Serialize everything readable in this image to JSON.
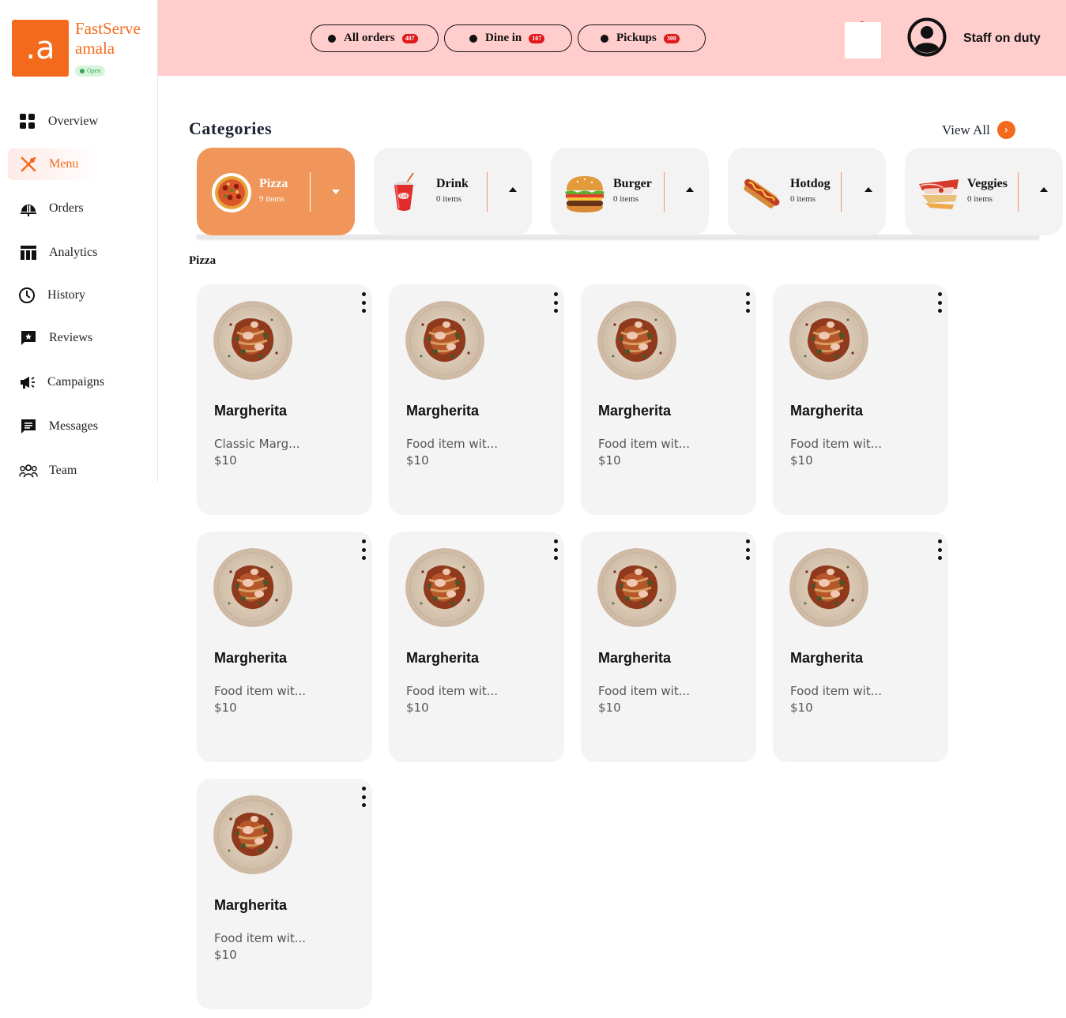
{
  "brand": {
    "logo": ".a",
    "name_line1": "FastServe",
    "name_line2": "amala",
    "status": "Open"
  },
  "nav": [
    {
      "label": "Overview",
      "icon": "grid-icon"
    },
    {
      "label": "Menu",
      "icon": "utensils-icon",
      "active": true
    },
    {
      "label": "Orders",
      "icon": "cloche-icon"
    },
    {
      "label": "Analytics",
      "icon": "table-icon"
    },
    {
      "label": "History",
      "icon": "clock-icon"
    },
    {
      "label": "Reviews",
      "icon": "review-icon"
    },
    {
      "label": "Campaigns",
      "icon": "megaphone-icon"
    },
    {
      "label": "Messages",
      "icon": "message-icon"
    },
    {
      "label": "Team",
      "icon": "team-icon"
    }
  ],
  "topbar": {
    "pills": [
      {
        "label": "All orders",
        "count": "407"
      },
      {
        "label": "Dine in",
        "count": "107"
      },
      {
        "label": "Pickups",
        "count": "300"
      }
    ],
    "staff_label": "Staff on duty"
  },
  "categories": {
    "title": "Categories",
    "view_all": "View All",
    "items": [
      {
        "name": "Pizza",
        "count": "9 items",
        "icon": "pizza-icon",
        "active": true
      },
      {
        "name": "Drink",
        "count": "0 items",
        "icon": "drink-icon"
      },
      {
        "name": "Burger",
        "count": "0 items",
        "icon": "burger-icon"
      },
      {
        "name": "Hotdog",
        "count": "0 items",
        "icon": "hotdog-icon"
      },
      {
        "name": "Veggies",
        "count": "0 items",
        "icon": "veggies-icon"
      }
    ]
  },
  "section": {
    "label": "Pizza"
  },
  "menu_items": [
    {
      "name": "Margherita",
      "desc": "Classic Marg...",
      "price": "$10"
    },
    {
      "name": "Margherita",
      "desc": "Food item wit...",
      "price": "$10"
    },
    {
      "name": "Margherita",
      "desc": "Food item wit...",
      "price": "$10"
    },
    {
      "name": "Margherita",
      "desc": "Food item wit...",
      "price": "$10"
    },
    {
      "name": "Margherita",
      "desc": "Food item wit...",
      "price": "$10"
    },
    {
      "name": "Margherita",
      "desc": "Food item wit...",
      "price": "$10"
    },
    {
      "name": "Margherita",
      "desc": "Food item wit...",
      "price": "$10"
    },
    {
      "name": "Margherita",
      "desc": "Food item wit...",
      "price": "$10"
    },
    {
      "name": "Margherita",
      "desc": "Food item wit...",
      "price": "$10"
    }
  ],
  "colors": {
    "accent": "#f46a1c",
    "topbar": "#ffcdcc",
    "active_category": "#f0965a",
    "badge": "#e11818"
  }
}
